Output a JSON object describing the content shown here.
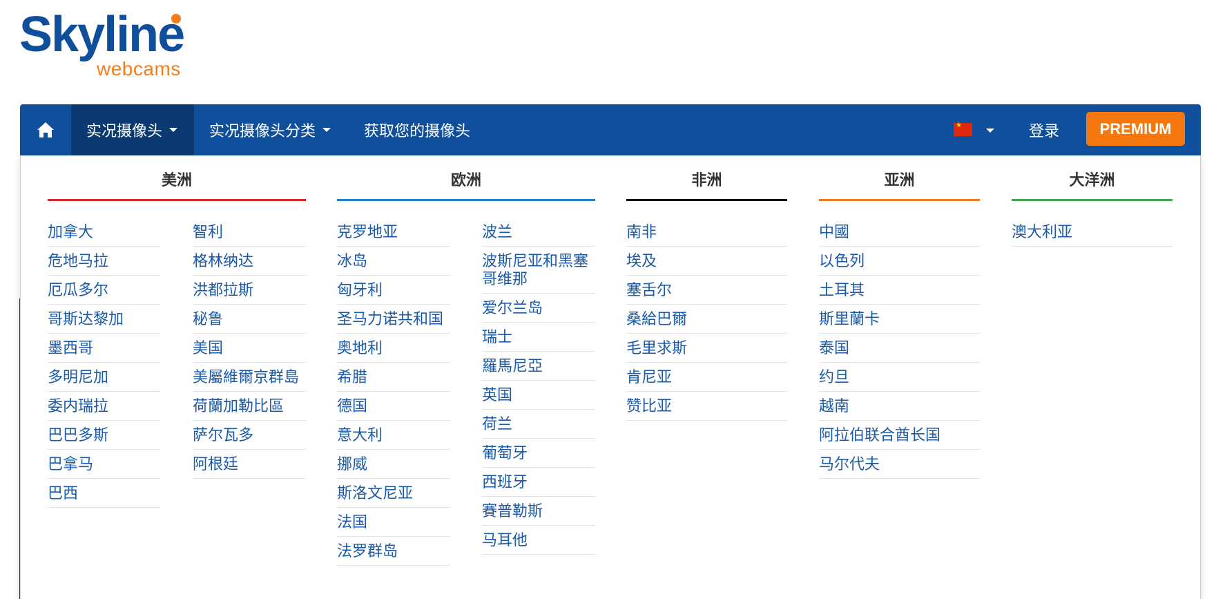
{
  "brand": {
    "name": "Skyline",
    "sub": "webcams"
  },
  "nav": {
    "live_cams": "实况摄像头",
    "categories": "实况摄像头分类",
    "get_cam": "获取您的摄像头",
    "login": "登录",
    "premium": "PREMIUM"
  },
  "regions": {
    "americas": {
      "title": "美洲",
      "color": "#d9252a",
      "col1": [
        "加拿大",
        "危地马拉",
        "厄瓜多尔",
        "哥斯达黎加",
        "墨西哥",
        "多明尼加",
        "委内瑞拉",
        "巴巴多斯",
        "巴拿马",
        "巴西"
      ],
      "col2": [
        "智利",
        "格林纳达",
        "洪都拉斯",
        "秘鲁",
        "美国",
        "美屬維爾京群島",
        "荷蘭加勒比區",
        "萨尔瓦多",
        "阿根廷"
      ]
    },
    "europe": {
      "title": "欧洲",
      "color": "#1f83c7",
      "col1": [
        "克罗地亚",
        "冰岛",
        "匈牙利",
        "圣马力诺共和国",
        "奥地利",
        "希腊",
        "德国",
        "意大利",
        "挪威",
        "斯洛文尼亚",
        "法国",
        "法罗群岛"
      ],
      "col2": [
        "波兰",
        "波斯尼亚和黑塞哥维那",
        "爱尔兰岛",
        "瑞士",
        "羅馬尼亞",
        "英国",
        "荷兰",
        "葡萄牙",
        "西班牙",
        "賽普勒斯",
        "马耳他"
      ]
    },
    "africa": {
      "title": "非洲",
      "color": "#111111",
      "col1": [
        "南非",
        "埃及",
        "塞舌尔",
        "桑給巴爾",
        "毛里求斯",
        "肯尼亚",
        "赞比亚"
      ]
    },
    "asia": {
      "title": "亚洲",
      "color": "#f47920",
      "col1": [
        "中國",
        "以色列",
        "土耳其",
        "斯里蘭卡",
        "泰国",
        "约旦",
        "越南",
        "阿拉伯联合酋长国",
        "马尔代夫"
      ]
    },
    "oceania": {
      "title": "大洋洲",
      "color": "#3aa84b",
      "col1": [
        "澳大利亚"
      ]
    }
  }
}
